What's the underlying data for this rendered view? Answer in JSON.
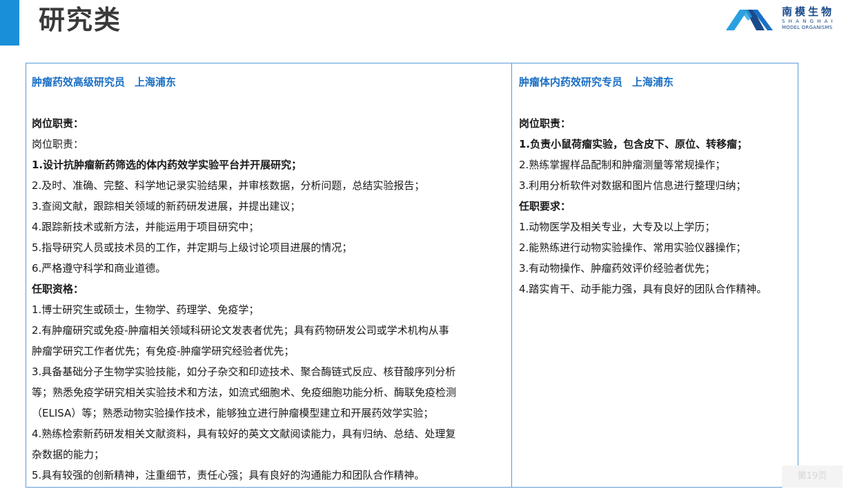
{
  "header": {
    "title": "研究类",
    "accent_color": "#1a8fd9"
  },
  "logo": {
    "name_cn": "南模生物",
    "name_en_1": "SHANGHAI",
    "name_en_2": "MODEL ORGANISMS",
    "icon": "mountain-logo-icon"
  },
  "jobs": [
    {
      "title": "肿瘤药效高级研究员",
      "location": "上海浦东",
      "lines": [
        {
          "text": "岗位职责：",
          "style": "section"
        },
        {
          "text": "岗位职责：",
          "style": "normal"
        },
        {
          "text": "1.设计抗肿瘤新药筛选的体内药效学实验平台并开展研究；",
          "style": "bold"
        },
        {
          "text": "2.及时、准确、完整、科学地记录实验结果，并审核数据，分析问题，总结实验报告；",
          "style": "normal"
        },
        {
          "text": "3.查阅文献，跟踪相关领域的新药研发进展，并提出建议；",
          "style": "normal"
        },
        {
          "text": "4.跟踪新技术或新方法，并能运用于项目研究中；",
          "style": "normal"
        },
        {
          "text": "5.指导研究人员或技术员的工作，并定期与上级讨论项目进展的情况；",
          "style": "normal"
        },
        {
          "text": "6.严格遵守科学和商业道德。",
          "style": "normal"
        },
        {
          "text": "任职资格：",
          "style": "section"
        },
        {
          "text": "1.博士研究生或硕士，生物学、药理学、免疫学；",
          "style": "normal"
        },
        {
          "text": "2.有肿瘤研究或免疫-肿瘤相关领域科研论文发表者优先；具有药物研发公司或学术机构从事",
          "style": "normal"
        },
        {
          "text": "肿瘤学研究工作者优先；有免疫-肿瘤学研究经验者优先；",
          "style": "normal"
        },
        {
          "text": "3.具备基础分子生物学实验技能，如分子杂交和印迹技术、聚合酶链式反应、核苷酸序列分析",
          "style": "normal"
        },
        {
          "text": "等；熟悉免疫学研究相关实验技术和方法，如流式细胞术、免疫细胞功能分析、酶联免疫检测",
          "style": "normal"
        },
        {
          "text": "（ELISA）等；熟悉动物实验操作技术，能够独立进行肿瘤模型建立和开展药效学实验；",
          "style": "normal"
        },
        {
          "text": "4.熟练检索新药研发相关文献资料，具有较好的英文文献阅读能力，具有归纳、总结、处理复",
          "style": "normal"
        },
        {
          "text": "杂数据的能力；",
          "style": "normal"
        },
        {
          "text": "5.具有较强的创新精神，注重细节，责任心强；具有良好的沟通能力和团队合作精神。",
          "style": "normal"
        }
      ]
    },
    {
      "title": "肿瘤体内药效研究专员",
      "location": "上海浦东",
      "lines": [
        {
          "text": "岗位职责：",
          "style": "section"
        },
        {
          "text": "1.负责小鼠荷瘤实验，包含皮下、原位、转移瘤；",
          "style": "bold"
        },
        {
          "text": "2.熟练掌握样品配制和肿瘤测量等常规操作；",
          "style": "normal"
        },
        {
          "text": "3.利用分析软件对数据和图片信息进行整理归纳；",
          "style": "normal"
        },
        {
          "text": "任职要求：",
          "style": "section"
        },
        {
          "text": "1.动物医学及相关专业，大专及以上学历；",
          "style": "normal"
        },
        {
          "text": "2.能熟练进行动物实验操作、常用实验仪器操作；",
          "style": "normal"
        },
        {
          "text": "3.有动物操作、肿瘤药效评价经验者优先；",
          "style": "normal"
        },
        {
          "text": "4.踏实肯干、动手能力强，具有良好的团队合作精神。",
          "style": "normal"
        }
      ]
    }
  ],
  "footer": {
    "page_label": "第19页"
  }
}
